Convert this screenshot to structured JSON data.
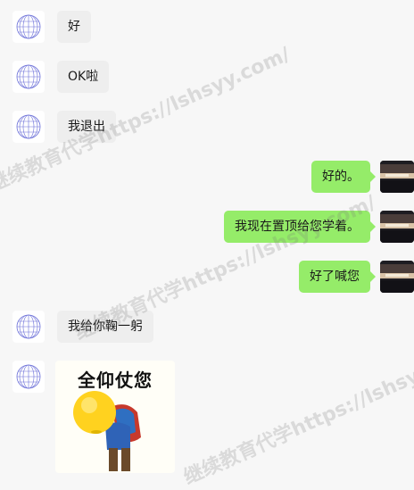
{
  "conversation": {
    "messages": [
      {
        "side": "left",
        "type": "text",
        "text": "好"
      },
      {
        "side": "left",
        "type": "text",
        "text": "OK啦"
      },
      {
        "side": "left",
        "type": "text",
        "text": "我退出"
      },
      {
        "side": "right",
        "type": "text",
        "text": "好的。"
      },
      {
        "side": "right",
        "type": "text",
        "text": "我现在置顶给您学着。"
      },
      {
        "side": "right",
        "type": "text",
        "text": "好了喊您"
      },
      {
        "side": "left",
        "type": "text",
        "text": "我给你鞠一躬"
      },
      {
        "side": "left",
        "type": "sticker",
        "caption": "全仰仗您"
      }
    ]
  },
  "watermark": {
    "text": "继续教育代学https://lshsyy.com/"
  },
  "icons": {
    "left_avatar": "globe-wireframe-icon",
    "right_avatar": "sunset-photo-icon",
    "sticker": "bowing-emoji-sticker"
  },
  "colors": {
    "background": "#f7f7f7",
    "incoming_bubble": "#eeeeee",
    "outgoing_bubble": "#95ec69",
    "watermark": "#787878"
  }
}
